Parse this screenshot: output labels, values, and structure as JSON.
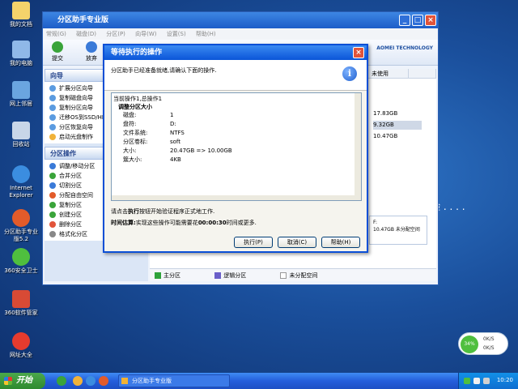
{
  "desktop": {
    "icons": [
      {
        "label": "我的文档",
        "color": "#f4d36b"
      },
      {
        "label": "我的电脑",
        "color": "#8fb8e8"
      },
      {
        "label": "网上邻居",
        "color": "#6aa5e0"
      },
      {
        "label": "回收站",
        "color": "#c8d6e8"
      },
      {
        "label": "Internet Explorer",
        "color": "#3b8de0"
      },
      {
        "label": "分区助手专业版5.2",
        "color": "#e25b2a"
      },
      {
        "label": "360安全卫士",
        "color": "#4fbf3e"
      },
      {
        "label": "360软件管家",
        "color": "#d84a35"
      },
      {
        "label": "网址大全",
        "color": "#e63b2e"
      }
    ],
    "side_text": "验 . . . ."
  },
  "app": {
    "title": "分区助手专业版",
    "menu": [
      "常规(G)",
      "磁盘(D)",
      "分区(P)",
      "向导(W)",
      "设置(S)",
      "帮助(H)"
    ],
    "toolbar": {
      "commit": "提交",
      "discard": "放弃"
    },
    "brand": "AOMEI TECHNOLOGY",
    "wizard_head": "向导",
    "wizard_items": [
      "扩展分区向导",
      "复制磁盘向导",
      "复制分区向导",
      "迁移OS到SSD/HDD",
      "分区恢复向导",
      "启动光盘制作"
    ],
    "ops_head": "分区操作",
    "ops_items": [
      "调整/移动分区",
      "合并分区",
      "切割分区",
      "分配自由空间",
      "复制分区",
      "创建分区",
      "删除分区",
      "格式化分区"
    ],
    "columns": {
      "unused": "未使用"
    },
    "sizes": [
      "17.83GB",
      "9.32GB",
      "10.47GB"
    ],
    "disk_right": {
      "line1": "F:",
      "line2": "10.47GB 未分配空间"
    },
    "legend": {
      "primary": "主分区",
      "logical": "逻辑分区",
      "unallocated": "未分配空间"
    }
  },
  "dialog": {
    "title": "等待执行的操作",
    "header_msg": "分区助手已经准备就绪,请确认下面的操作.",
    "total": "当前操作1,总操作1",
    "op_name": "调整分区大小",
    "rows": [
      {
        "k": "磁盘:",
        "v": "1"
      },
      {
        "k": "盘符:",
        "v": "D:"
      },
      {
        "k": "文件系统:",
        "v": "NTFS"
      },
      {
        "k": "分区卷标:",
        "v": "soft"
      },
      {
        "k": "大小:",
        "v": "20.47GB => 10.00GB"
      },
      {
        "k": "簇大小:",
        "v": "4KB"
      }
    ],
    "hint_pre": "请点击",
    "hint_bold": "执行",
    "hint_post": "按钮开始验证程序正式地工作.",
    "time_label": "时间估算:",
    "time_pre": "实现这些操作可能需要花",
    "time_bold": "00:00:30",
    "time_post": "时间或更多.",
    "buttons": {
      "execute": "执行(P)",
      "cancel": "取消(C)",
      "help": "帮助(H)"
    }
  },
  "taskbar": {
    "start": "开始",
    "task": "分区助手专业版",
    "clock": "10:20"
  },
  "widget": {
    "pct": "34%",
    "up": "0K/S",
    "down": "0K/S"
  }
}
